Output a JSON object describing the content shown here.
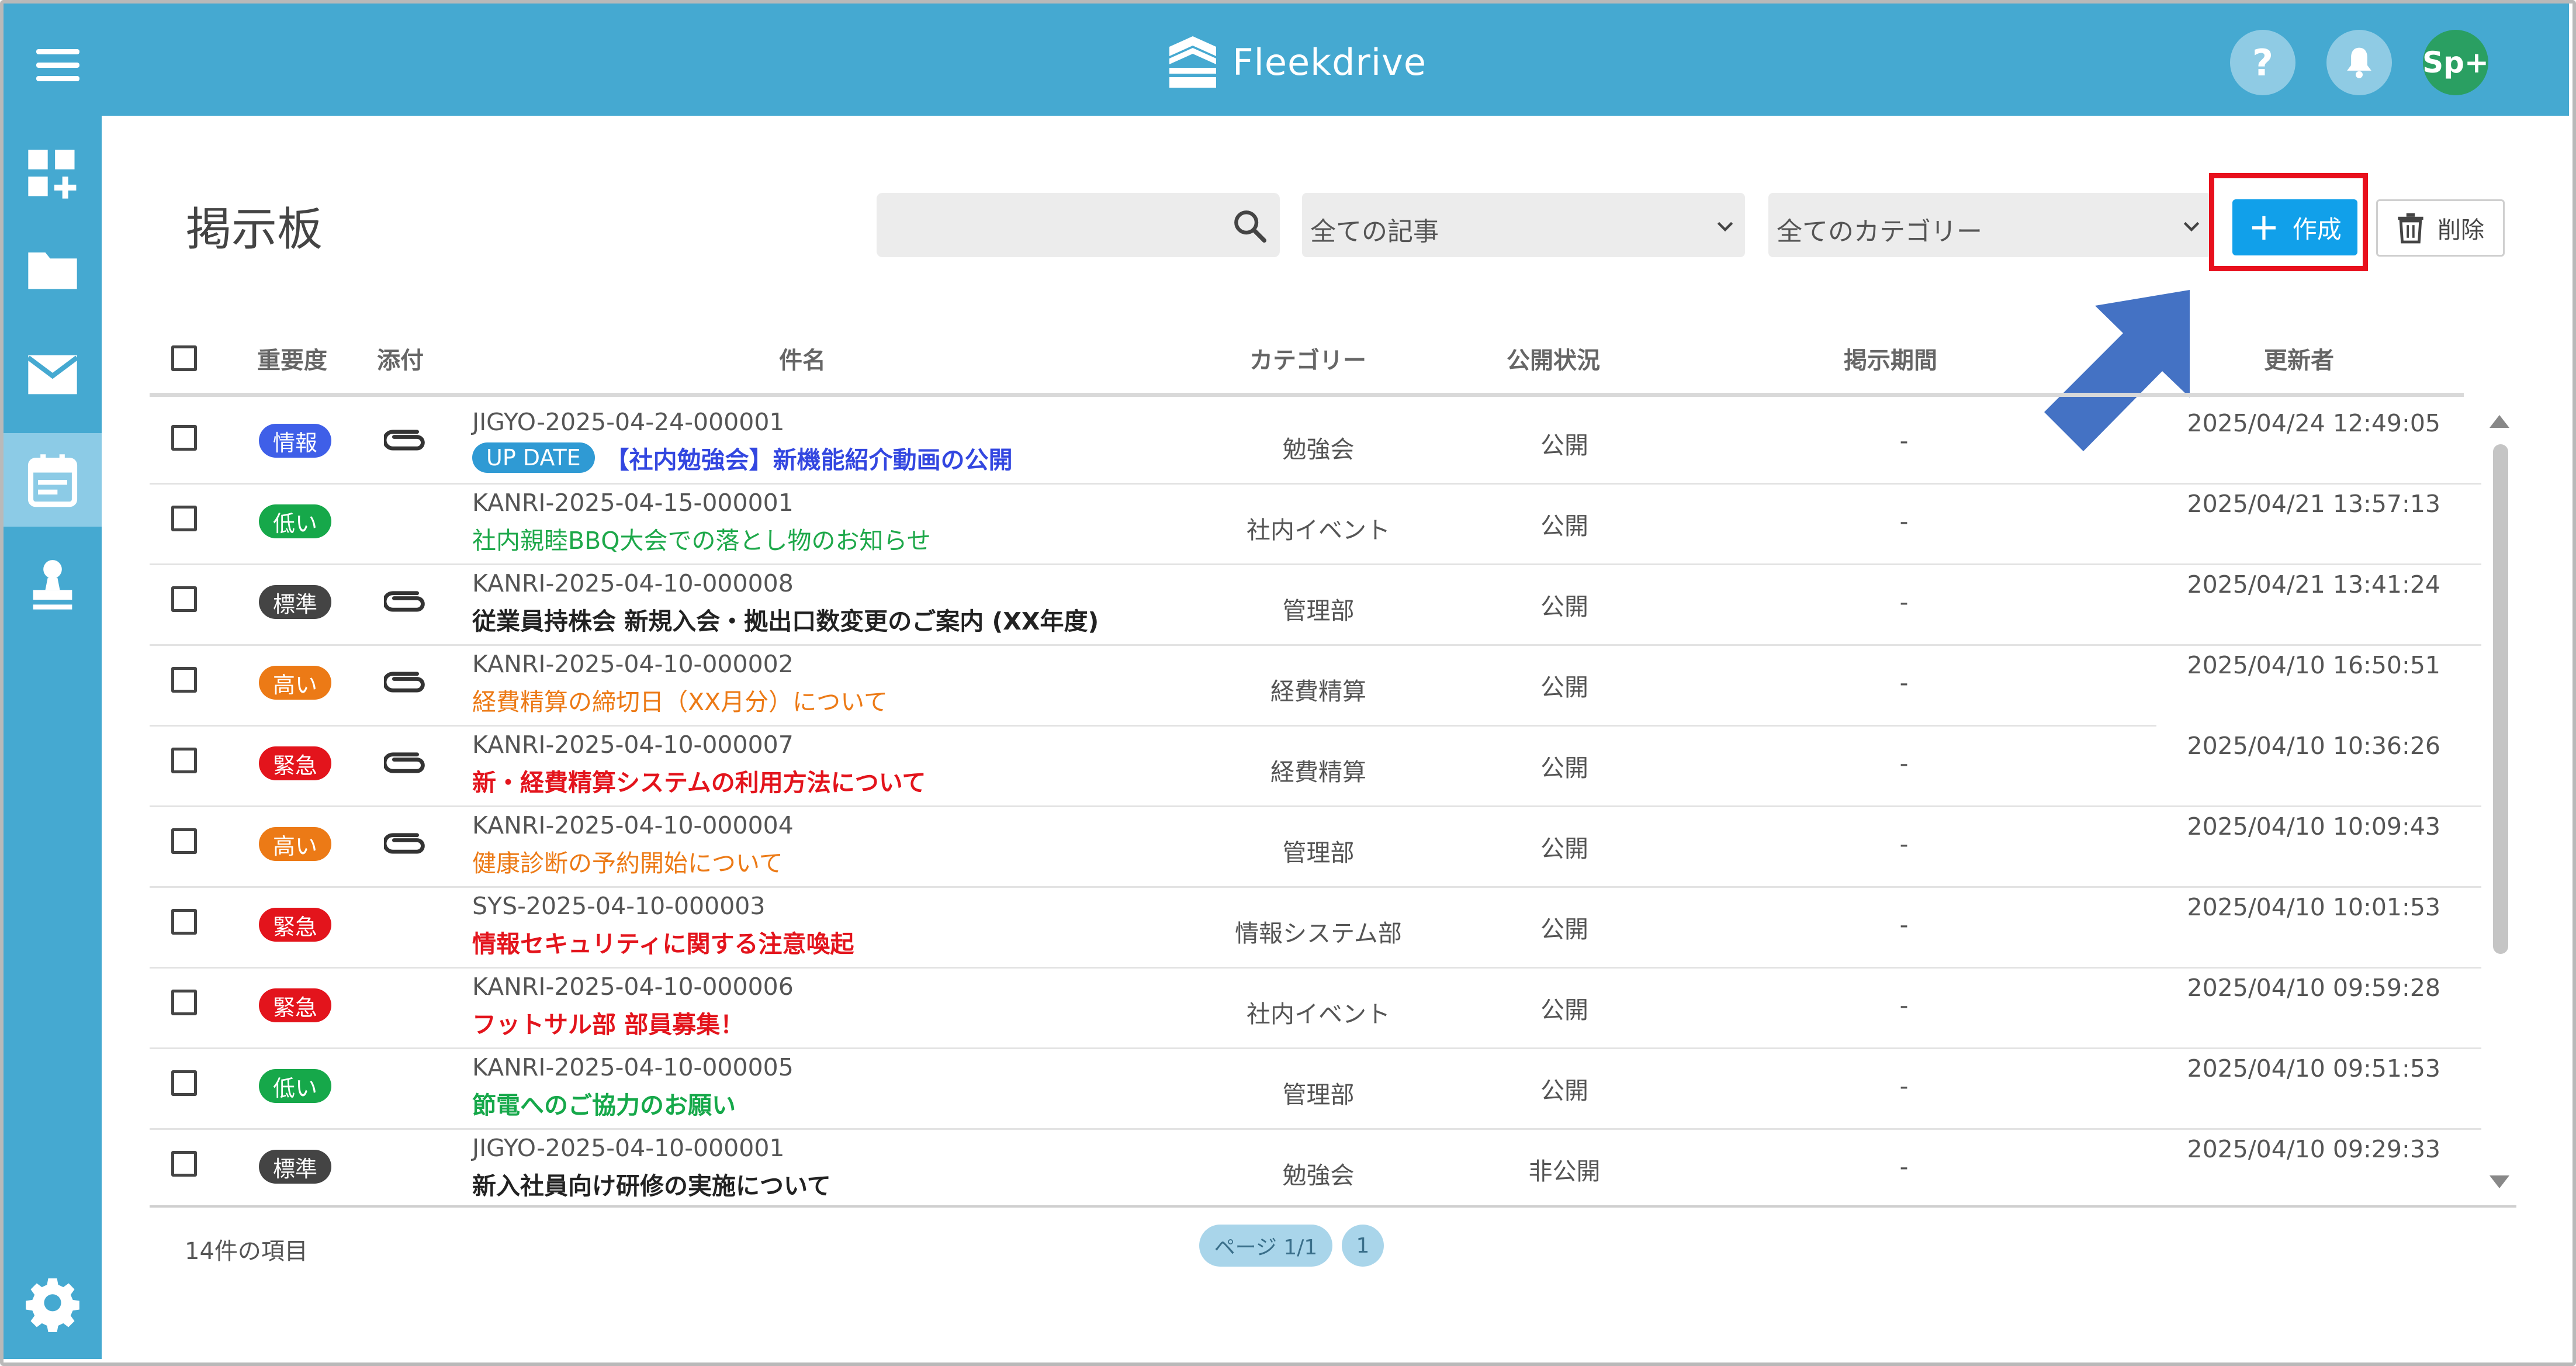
{
  "header": {
    "app_name": "Fleekdrive",
    "help_label": "?",
    "avatar_label": "Sp+"
  },
  "page": {
    "title": "掲示板"
  },
  "toolbar": {
    "search_placeholder": "",
    "article_filter": "全ての記事",
    "category_filter": "全てのカテゴリー",
    "create_label": "作成",
    "delete_label": "削除"
  },
  "table": {
    "columns": {
      "priority": "重要度",
      "attachment": "添付",
      "subject": "件名",
      "category": "カテゴリー",
      "status": "公開状況",
      "period": "掲示期間",
      "updated_by": "更新者"
    },
    "rows": [
      {
        "priority": "情報",
        "priority_color": "#3f5fe8",
        "attachment": true,
        "id": "JIGYO-2025-04-24-000001",
        "tag": "UP DATE",
        "subject": "【社内勉強会】新機能紹介動画の公開",
        "subject_color": "#3347e0",
        "bold": true,
        "category": "勉強会",
        "status": "公開",
        "period": "-",
        "updated": "2025/04/24 12:49:05"
      },
      {
        "priority": "低い",
        "priority_color": "#16a84a",
        "attachment": false,
        "id": "KANRI-2025-04-15-000001",
        "tag": "",
        "subject": "社内親睦BBQ大会での落とし物のお知らせ",
        "subject_color": "#1ea84a",
        "bold": false,
        "category": "社内イベント",
        "status": "公開",
        "period": "-",
        "updated": "2025/04/21 13:57:13"
      },
      {
        "priority": "標準",
        "priority_color": "#444444",
        "attachment": true,
        "id": "KANRI-2025-04-10-000008",
        "tag": "",
        "subject": "従業員持株会 新規入会・拠出口数変更のご案内 (XX年度)",
        "subject_color": "#222222",
        "bold": true,
        "category": "管理部",
        "status": "公開",
        "period": "-",
        "updated": "2025/04/21 13:41:24"
      },
      {
        "priority": "高い",
        "priority_color": "#ec7a16",
        "attachment": true,
        "id": "KANRI-2025-04-10-000002",
        "tag": "",
        "subject": "経費精算の締切日（XX月分）について",
        "subject_color": "#ec7a16",
        "bold": false,
        "category": "経費精算",
        "status": "公開",
        "period": "-",
        "updated": "2025/04/10 16:50:51"
      },
      {
        "priority": "緊急",
        "priority_color": "#e3141c",
        "attachment": true,
        "id": "KANRI-2025-04-10-000007",
        "tag": "",
        "subject": "新・経費精算システムの利用方法について",
        "subject_color": "#e3141c",
        "bold": true,
        "category": "経費精算",
        "status": "公開",
        "period": "-",
        "updated": "2025/04/10 10:36:26"
      },
      {
        "priority": "高い",
        "priority_color": "#ec7a16",
        "attachment": true,
        "id": "KANRI-2025-04-10-000004",
        "tag": "",
        "subject": "健康診断の予約開始について",
        "subject_color": "#ec7a16",
        "bold": false,
        "category": "管理部",
        "status": "公開",
        "period": "-",
        "updated": "2025/04/10 10:09:43"
      },
      {
        "priority": "緊急",
        "priority_color": "#e3141c",
        "attachment": false,
        "id": "SYS-2025-04-10-000003",
        "tag": "",
        "subject": "情報セキュリティに関する注意喚起",
        "subject_color": "#e3141c",
        "bold": true,
        "category": "情報システム部",
        "status": "公開",
        "period": "-",
        "updated": "2025/04/10 10:01:53"
      },
      {
        "priority": "緊急",
        "priority_color": "#e3141c",
        "attachment": false,
        "id": "KANRI-2025-04-10-000006",
        "tag": "",
        "subject": "フットサル部 部員募集！",
        "subject_color": "#e3141c",
        "bold": true,
        "category": "社内イベント",
        "status": "公開",
        "period": "-",
        "updated": "2025/04/10 09:59:28"
      },
      {
        "priority": "低い",
        "priority_color": "#16a84a",
        "attachment": false,
        "id": "KANRI-2025-04-10-000005",
        "tag": "",
        "subject": "節電へのご協力のお願い",
        "subject_color": "#16a84a",
        "bold": true,
        "category": "管理部",
        "status": "公開",
        "period": "-",
        "updated": "2025/04/10 09:51:53"
      },
      {
        "priority": "標準",
        "priority_color": "#444444",
        "attachment": false,
        "id": "JIGYO-2025-04-10-000001",
        "tag": "",
        "subject": "新入社員向け研修の実施について",
        "subject_color": "#222222",
        "bold": true,
        "category": "勉強会",
        "status": "非公開",
        "period": "-",
        "updated": "2025/04/10 09:29:33"
      }
    ]
  },
  "footer": {
    "count": "14件の項目",
    "page_label": "ページ 1/1",
    "page_number": "1"
  },
  "colors": {
    "header": "#45a9d1",
    "accent": "#11a0ea",
    "highlight": "#e8101d",
    "arrow": "#4472c4"
  }
}
